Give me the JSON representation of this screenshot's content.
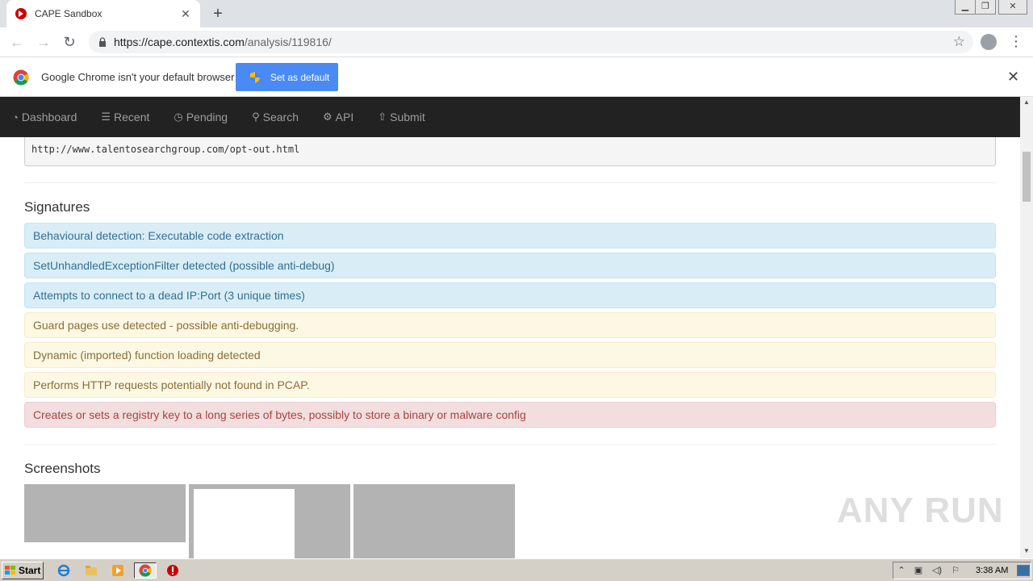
{
  "browser": {
    "tab_title": "CAPE Sandbox",
    "url_host": "https://cape.contextis.com",
    "url_path": "/analysis/119816/",
    "new_tab_label": "+",
    "tab_close_label": "✕"
  },
  "infobar": {
    "message": "Google Chrome isn't your default browser",
    "button_label": "Set as default",
    "close_label": "✕"
  },
  "navbar": {
    "items": [
      {
        "label": "Dashboard",
        "icon": "dashboard-icon"
      },
      {
        "label": "Recent",
        "icon": "list-icon"
      },
      {
        "label": "Pending",
        "icon": "clock-icon"
      },
      {
        "label": "Search",
        "icon": "search-icon"
      },
      {
        "label": "API",
        "icon": "gear-icon"
      },
      {
        "label": "Submit",
        "icon": "upload-icon"
      }
    ]
  },
  "page": {
    "url_text": "http://www.talentosearchgroup.com/opt-out.html",
    "signatures_title": "Signatures",
    "signatures": [
      {
        "text": "Behavioural detection: Executable code extraction",
        "level": "info"
      },
      {
        "text": "SetUnhandledExceptionFilter detected (possible anti-debug)",
        "level": "info"
      },
      {
        "text": "Attempts to connect to a dead IP:Port (3 unique times)",
        "level": "info"
      },
      {
        "text": "Guard pages use detected - possible anti-debugging.",
        "level": "warning"
      },
      {
        "text": "Dynamic (imported) function loading detected",
        "level": "warning"
      },
      {
        "text": "Performs HTTP requests potentially not found in PCAP.",
        "level": "warning"
      },
      {
        "text": "Creates or sets a registry key to a long series of bytes, possibly to store a binary or malware config",
        "level": "danger"
      }
    ],
    "screenshots_title": "Screenshots"
  },
  "watermark": "ANY RUN",
  "taskbar": {
    "start_label": "Start",
    "clock": "3:38 AM"
  }
}
